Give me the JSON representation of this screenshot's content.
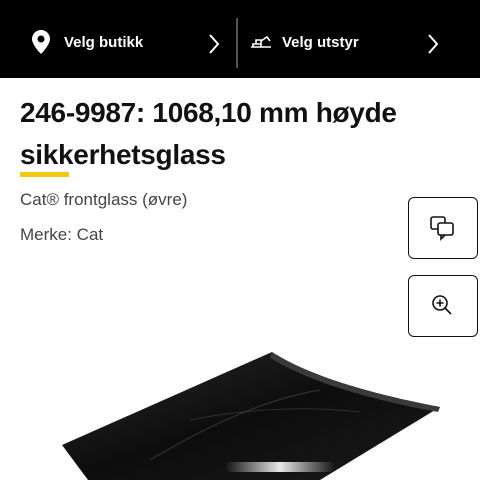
{
  "header": {
    "store_label": "Velg butikk",
    "equipment_label": "Velg utstyr",
    "store_icon": "location-pin-icon",
    "equipment_icon": "excavator-icon",
    "chevron_icon": "chevron-right-icon",
    "background": "#000000"
  },
  "product": {
    "title_line1": "246-9987: 1068,10 mm høyde",
    "title_line2": "sikkerhetsglass",
    "description": "Cat® frontglass (øvre)",
    "brand": "Merke: Cat",
    "accent_color": "#f2c811"
  },
  "actions": {
    "compare_icon": "compare-icon",
    "zoom_icon": "zoom-in-icon"
  },
  "image": {
    "subject": "product-glass-image"
  }
}
